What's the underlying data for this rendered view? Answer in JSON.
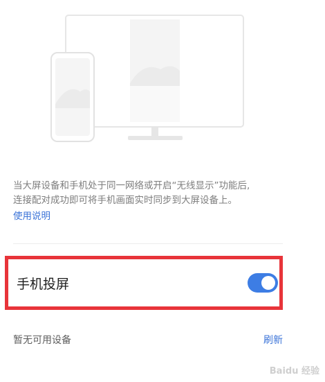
{
  "illustration": {
    "name": "phone-to-tv-cast-illustration"
  },
  "description": {
    "line1": "当大屏设备和手机处于同一网络或开启“无线显示”功能后,",
    "line2": "连接配对成功即可将手机画面实时同步到大屏设备上。"
  },
  "help_link": "使用说明",
  "cast_toggle": {
    "label": "手机投屏",
    "state": "on",
    "color": "#3d7de4"
  },
  "devices": {
    "empty_text": "暂无可用设备",
    "refresh_label": "刷新"
  },
  "watermark": "Baidu 经验",
  "colors": {
    "accent": "#3c74d8",
    "highlight_border": "#e8343a"
  }
}
